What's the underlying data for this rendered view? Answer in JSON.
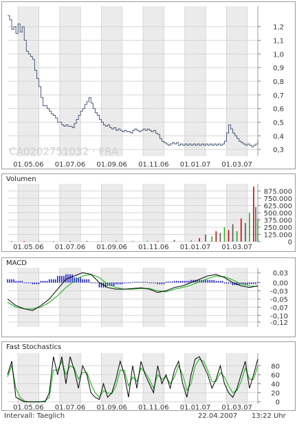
{
  "xticks": [
    "01.05.06",
    "01.07.06",
    "01.09.06",
    "01.11.06",
    "01.01.07",
    "01.03.07"
  ],
  "chart_data": [
    {
      "type": "line",
      "watermark": "CA0202751032 · FRA",
      "ylim": [
        0.25,
        1.35
      ],
      "yticks": [
        "1,2",
        "1,1",
        "1,0",
        "0,9",
        "0,8",
        "0,7",
        "0,6",
        "0,5",
        "0,4",
        "0,3"
      ],
      "ytick_values": [
        1.2,
        1.1,
        1.0,
        0.9,
        0.8,
        0.7,
        0.6,
        0.5,
        0.4,
        0.3
      ],
      "x": [
        0,
        1,
        2,
        3,
        4,
        5,
        6,
        7,
        8,
        9,
        10,
        11,
        12,
        13,
        14,
        15,
        16,
        17,
        18,
        19,
        20,
        21,
        22,
        23,
        24,
        25,
        26,
        27,
        28,
        29,
        30,
        31,
        32,
        33,
        34,
        35,
        36,
        37,
        38,
        39,
        40,
        41,
        42,
        43,
        44,
        45,
        46,
        47,
        48,
        49,
        50,
        51,
        52,
        53,
        54,
        55,
        56,
        57,
        58,
        59,
        60,
        61,
        62,
        63,
        64,
        65,
        66,
        67,
        68,
        69,
        70,
        71,
        72,
        73,
        74,
        75,
        76,
        77,
        78,
        79,
        80,
        81,
        82,
        83,
        84,
        85,
        86,
        87,
        88,
        89,
        90,
        91,
        92,
        93,
        94,
        95,
        96,
        97,
        98,
        99,
        100,
        101,
        102,
        103,
        104,
        105,
        106,
        107,
        108,
        109,
        110,
        111,
        112,
        113,
        114,
        115,
        116,
        117,
        118,
        119,
        120
      ],
      "values": [
        1.28,
        1.25,
        1.18,
        1.2,
        1.15,
        1.22,
        1.16,
        1.2,
        1.1,
        1.02,
        1.0,
        0.98,
        0.96,
        0.88,
        0.82,
        0.76,
        0.68,
        0.62,
        0.62,
        0.6,
        0.58,
        0.56,
        0.55,
        0.53,
        0.5,
        0.5,
        0.48,
        0.47,
        0.48,
        0.47,
        0.47,
        0.46,
        0.49,
        0.52,
        0.55,
        0.58,
        0.6,
        0.63,
        0.65,
        0.68,
        0.64,
        0.6,
        0.57,
        0.55,
        0.52,
        0.5,
        0.48,
        0.47,
        0.48,
        0.46,
        0.45,
        0.46,
        0.44,
        0.45,
        0.44,
        0.43,
        0.44,
        0.43,
        0.43,
        0.42,
        0.44,
        0.45,
        0.44,
        0.43,
        0.44,
        0.45,
        0.44,
        0.45,
        0.44,
        0.43,
        0.44,
        0.42,
        0.41,
        0.38,
        0.36,
        0.35,
        0.34,
        0.33,
        0.34,
        0.35,
        0.34,
        0.35,
        0.33,
        0.34,
        0.33,
        0.34,
        0.33,
        0.34,
        0.33,
        0.34,
        0.33,
        0.34,
        0.33,
        0.34,
        0.33,
        0.34,
        0.33,
        0.34,
        0.33,
        0.34,
        0.33,
        0.34,
        0.33,
        0.34,
        0.36,
        0.42,
        0.48,
        0.45,
        0.42,
        0.4,
        0.38,
        0.36,
        0.35,
        0.34,
        0.33,
        0.34,
        0.33,
        0.32,
        0.33,
        0.34,
        0.37
      ]
    },
    {
      "type": "bar",
      "title": "Volumen",
      "ylim": [
        0,
        1000000
      ],
      "yticks": [
        "875.000",
        "750.000",
        "625.000",
        "500.000",
        "375.000",
        "250.000",
        "125.000",
        "0"
      ],
      "ytick_values": [
        875000,
        750000,
        625000,
        500000,
        375000,
        250000,
        125000,
        0
      ],
      "x": [
        2,
        8,
        15,
        22,
        30,
        38,
        45,
        52,
        60,
        67,
        72,
        80,
        88,
        92,
        95,
        98,
        100,
        102,
        104,
        106,
        108,
        110,
        112,
        114,
        116,
        118,
        119,
        120
      ],
      "values": [
        8000,
        6000,
        10000,
        5000,
        7000,
        12000,
        6000,
        9000,
        8000,
        14000,
        10000,
        30000,
        20000,
        60000,
        120000,
        90000,
        180000,
        150000,
        250000,
        200000,
        300000,
        180000,
        400000,
        320000,
        500000,
        950000,
        600000,
        400000
      ]
    },
    {
      "type": "bar",
      "title": "MACD",
      "ylim": [
        -0.135,
        0.045
      ],
      "yticks": [
        "0,03",
        "0,00",
        "-0,03",
        "-0,05",
        "-0,07",
        "-0,10",
        "-0,12"
      ],
      "ytick_values": [
        0.03,
        0.0,
        -0.025,
        -0.05,
        -0.075,
        -0.1,
        -0.12
      ],
      "macd_x": [
        0,
        4,
        8,
        12,
        16,
        20,
        24,
        28,
        32,
        36,
        40,
        44,
        48,
        52,
        56,
        60,
        64,
        68,
        72,
        76,
        80,
        84,
        88,
        92,
        96,
        100,
        104,
        108,
        112,
        116,
        120
      ],
      "macd": [
        -0.05,
        -0.07,
        -0.08,
        -0.085,
        -0.07,
        -0.05,
        -0.02,
        0.01,
        0.02,
        0.03,
        0.025,
        0.0,
        -0.015,
        -0.02,
        -0.02,
        -0.018,
        -0.016,
        -0.02,
        -0.03,
        -0.025,
        -0.015,
        -0.01,
        0.0,
        0.01,
        0.02,
        0.025,
        0.015,
        0.0,
        -0.01,
        -0.015,
        -0.01
      ],
      "signal": [
        -0.06,
        -0.075,
        -0.08,
        -0.08,
        -0.075,
        -0.06,
        -0.04,
        -0.015,
        0.005,
        0.02,
        0.025,
        0.015,
        -0.005,
        -0.015,
        -0.02,
        -0.02,
        -0.018,
        -0.018,
        -0.025,
        -0.028,
        -0.02,
        -0.015,
        -0.008,
        0.002,
        0.012,
        0.02,
        0.018,
        0.008,
        -0.004,
        -0.01,
        -0.012
      ],
      "histogram": [
        0.01,
        0.005,
        0.0,
        -0.005,
        0.005,
        0.01,
        0.02,
        0.025,
        0.015,
        0.01,
        0.0,
        -0.015,
        -0.01,
        -0.005,
        0.0,
        0.002,
        0.002,
        -0.002,
        -0.005,
        0.003,
        0.005,
        0.005,
        0.008,
        0.008,
        0.008,
        0.005,
        -0.003,
        -0.008,
        -0.006,
        -0.005,
        0.002
      ],
      "colors": {
        "macd": "#000000",
        "signal": "#2db82d",
        "histogram": "#0000cc"
      }
    },
    {
      "type": "line",
      "title": "Fast Stochastics",
      "ylim": [
        -5,
        108
      ],
      "yticks": [
        "80",
        "60",
        "40",
        "20",
        "0"
      ],
      "ytick_values": [
        80,
        60,
        40,
        20,
        0
      ],
      "x": [
        0,
        2,
        4,
        6,
        8,
        10,
        12,
        14,
        16,
        18,
        20,
        22,
        24,
        26,
        28,
        30,
        32,
        34,
        36,
        38,
        40,
        42,
        44,
        46,
        48,
        50,
        52,
        54,
        56,
        58,
        60,
        62,
        64,
        66,
        68,
        70,
        72,
        74,
        76,
        78,
        80,
        82,
        84,
        86,
        88,
        90,
        92,
        94,
        96,
        98,
        100,
        102,
        104,
        106,
        108,
        110,
        112,
        114,
        116,
        118,
        120
      ],
      "k": [
        60,
        90,
        10,
        5,
        0,
        0,
        0,
        0,
        0,
        0,
        20,
        100,
        60,
        100,
        40,
        100,
        70,
        30,
        80,
        60,
        20,
        10,
        5,
        40,
        10,
        20,
        50,
        90,
        60,
        10,
        80,
        30,
        90,
        60,
        40,
        20,
        80,
        40,
        60,
        30,
        70,
        90,
        40,
        10,
        60,
        95,
        100,
        80,
        60,
        30,
        50,
        80,
        40,
        20,
        10,
        30,
        60,
        90,
        30,
        60,
        95
      ],
      "d": [
        55,
        80,
        30,
        10,
        2,
        0,
        0,
        0,
        0,
        2,
        10,
        70,
        70,
        90,
        60,
        80,
        75,
        50,
        65,
        65,
        40,
        20,
        10,
        25,
        20,
        18,
        35,
        70,
        70,
        35,
        55,
        45,
        75,
        65,
        50,
        30,
        60,
        50,
        55,
        40,
        55,
        80,
        60,
        25,
        40,
        80,
        95,
        90,
        70,
        45,
        45,
        65,
        55,
        35,
        20,
        25,
        45,
        75,
        50,
        50,
        80
      ],
      "colors": {
        "k": "#000000",
        "d": "#2db82d"
      }
    }
  ],
  "footer": {
    "interval": "Intervall:  Taeglich",
    "date": "22.04.2007",
    "time": "13:22 Uhr"
  }
}
